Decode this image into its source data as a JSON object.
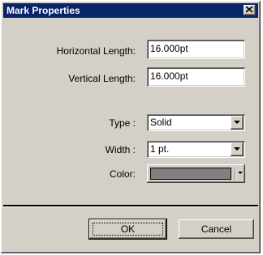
{
  "window": {
    "title": "Mark Properties",
    "close_icon": "close-icon"
  },
  "fields": {
    "horizontal_length_label": "Horizontal Length:",
    "horizontal_length_value": "16.000pt",
    "vertical_length_label": "Vertical Length:",
    "vertical_length_value": "16.000pt"
  },
  "stroke": {
    "type_label": "Type :",
    "type_value": "Solid",
    "width_label": "Width :",
    "width_value": "1 pt.",
    "color_label": "Color:",
    "color_value": "#808080"
  },
  "buttons": {
    "ok": "OK",
    "cancel": "Cancel"
  },
  "colors": {
    "titlebar": "#0a246a",
    "face": "#d4d0c8"
  }
}
